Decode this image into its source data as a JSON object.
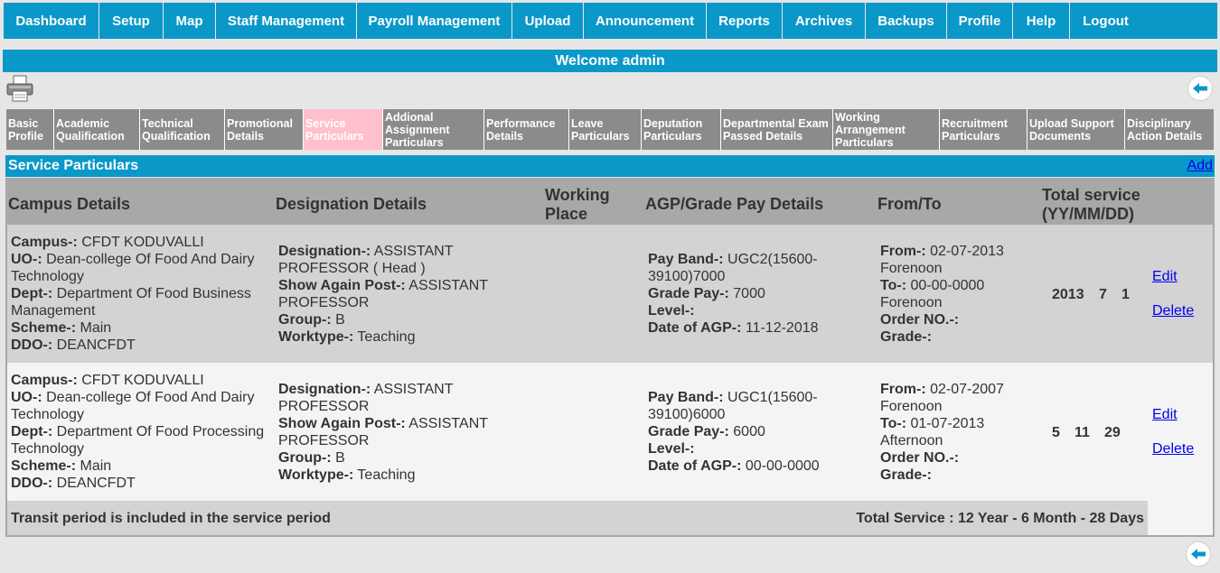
{
  "nav": [
    "Dashboard",
    "Setup",
    "Map",
    "Staff Management",
    "Payroll Management",
    "Upload",
    "Announcement",
    "Reports",
    "Archives",
    "Backups",
    "Profile",
    "Help",
    "Logout"
  ],
  "welcome": "Welcome admin",
  "subtabs": [
    "Basic Profile",
    "Academic Qualification",
    "Technical Qualification",
    "Promotional Details",
    "Service Particulars",
    "Addional Assignment Particulars",
    "Performance Details",
    "Leave Particulars",
    "Deputation Particulars",
    "Departmental Exam Passed Details",
    "Working Arrangement Particulars",
    "Recruitment Particulars",
    "Upload Support Documents",
    "Disciplinary Action Details"
  ],
  "active_subtab": "Service Particulars",
  "panel": {
    "title": "Service Particulars",
    "add_label": "Add"
  },
  "columns": {
    "campus": "Campus Details",
    "designation": "Designation Details",
    "working_place": "Working Place",
    "agp": "AGP/Grade Pay Details",
    "from_to": "From/To",
    "total": "Total service (YY/MM/DD)"
  },
  "labels": {
    "campus": "Campus-:",
    "uo": "UO-:",
    "dept": "Dept-:",
    "scheme": "Scheme-:",
    "ddo": "DDO-:",
    "designation": "Designation-:",
    "show_again_post": "Show Again Post-:",
    "group": "Group-:",
    "worktype": "Worktype-:",
    "pay_band": "Pay Band-:",
    "grade_pay": "Grade Pay-:",
    "level": "Level-:",
    "date_agp": "Date of AGP-:",
    "from": "From-:",
    "to": "To-:",
    "order_no": "Order NO.-:",
    "grade": "Grade-:",
    "edit": "Edit",
    "delete": "Delete"
  },
  "rows": [
    {
      "campus": "CFDT KODUVALLI",
      "uo": "Dean-college Of Food And Dairy Technology",
      "dept": "Department Of Food Business Management",
      "scheme": "Main",
      "ddo": "DEANCFDT",
      "designation": "ASSISTANT PROFESSOR ( Head )",
      "show_again_post": "ASSISTANT PROFESSOR",
      "group": "B",
      "worktype": "Teaching",
      "pay_band": "UGC2(15600-39100)7000",
      "grade_pay": "7000",
      "level": "",
      "date_agp": "11-12-2018",
      "from": "02-07-2013 Forenoon",
      "to": "00-00-0000 Forenoon",
      "order_no": "",
      "grade": "",
      "yy": "2013",
      "mm": "7",
      "dd": "1"
    },
    {
      "campus": "CFDT KODUVALLI",
      "uo": "Dean-college Of Food And Dairy Technology",
      "dept": "Department Of Food Processing Technology",
      "scheme": "Main",
      "ddo": "DEANCFDT",
      "designation": "ASSISTANT PROFESSOR",
      "show_again_post": "ASSISTANT PROFESSOR",
      "group": "B",
      "worktype": "Teaching",
      "pay_band": "UGC1(15600-39100)6000",
      "grade_pay": "6000",
      "level": "",
      "date_agp": "00-00-0000",
      "from": "02-07-2007 Forenoon",
      "to": "01-07-2013 Afternoon",
      "order_no": "",
      "grade": "",
      "yy": "5",
      "mm": "11",
      "dd": "29"
    }
  ],
  "footer": {
    "note": "Transit period is included in the service period",
    "total": "Total Service : 12 Year - 6 Month - 28 Days"
  },
  "icons": {
    "printer": "printer-icon",
    "back": "back-arrow-icon"
  },
  "colors": {
    "primary": "#0a98c8",
    "active_tab": "#ffc0cb",
    "tab": "#8b8b8b"
  }
}
